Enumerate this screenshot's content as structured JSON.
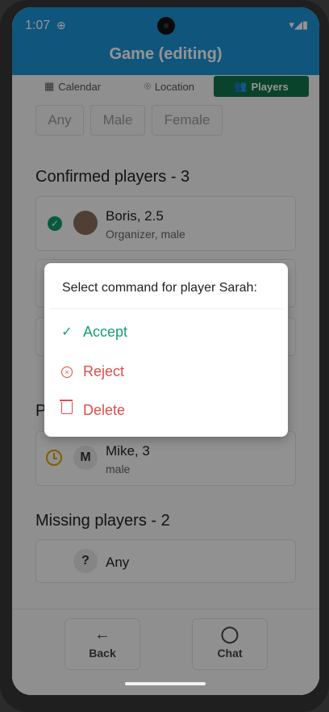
{
  "status": {
    "time": "1:07",
    "globe_icon": "globe-icon",
    "icons": "▾◢▮"
  },
  "appbar": {
    "title": "Game (editing)"
  },
  "tabs": [
    {
      "label": "Calendar",
      "icon": "calendar-icon"
    },
    {
      "label": "Location",
      "icon": "location-pin-icon"
    },
    {
      "label": "Players",
      "icon": "people-icon",
      "active": true
    }
  ],
  "filters": [
    "Any",
    "Male",
    "Female"
  ],
  "confirmed": {
    "title": "Confirmed players - 3",
    "players": [
      {
        "name": "Boris, 2.5",
        "sub": "Organizer, male"
      }
    ]
  },
  "pending": {
    "title_partial": "P",
    "players": [
      {
        "initial": "M",
        "name": "Mike, 3",
        "sub": "male"
      }
    ]
  },
  "missing": {
    "title": "Missing players - 2",
    "slots": [
      {
        "initial": "?",
        "label": "Any"
      }
    ]
  },
  "bottom": {
    "back": "Back",
    "chat": "Chat"
  },
  "dialog": {
    "title": "Select command for player Sarah:",
    "items": [
      {
        "label": "Accept",
        "icon": "check-icon"
      },
      {
        "label": "Reject",
        "icon": "x-circle-icon"
      },
      {
        "label": "Delete",
        "icon": "trash-icon"
      }
    ]
  },
  "colors": {
    "primary": "#1a93d6",
    "tab_active": "#12744a",
    "accept": "#12a074",
    "danger": "#e44b4b"
  }
}
